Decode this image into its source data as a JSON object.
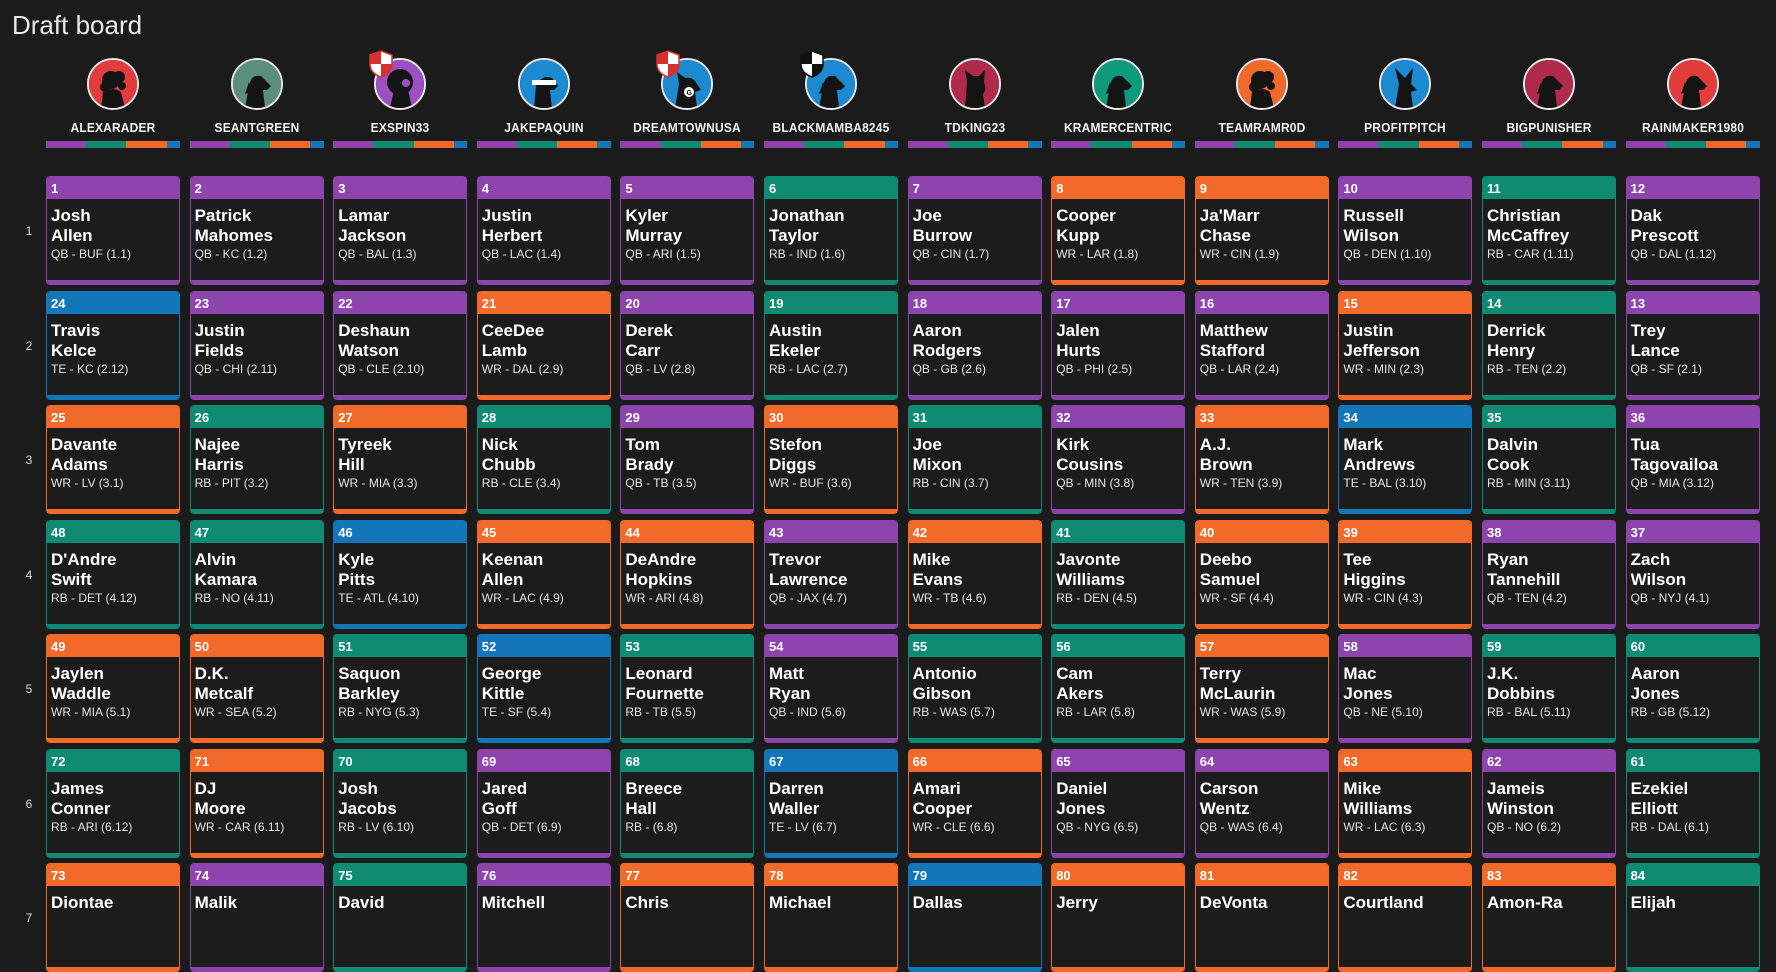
{
  "title": "Draft board",
  "colors": {
    "QB": "#8e44ad",
    "RB": "#0f8b74",
    "WR": "#f26a2a",
    "TE": "#1276b8"
  },
  "teams": [
    {
      "name": "ALEXARADER",
      "avatar_bg": "#e23c3c",
      "icon": "poodle-icon",
      "shield": false
    },
    {
      "name": "SEANTGREEN",
      "avatar_bg": "#5b8e7d",
      "icon": "dog-icon",
      "shield": false
    },
    {
      "name": "EXSPIN33",
      "avatar_bg": "#9b4fc0",
      "icon": "lion-icon",
      "shield": true,
      "shield_colors": [
        "#d8302e",
        "#ffffff"
      ]
    },
    {
      "name": "JAKEPAQUIN",
      "avatar_bg": "#1b8ad0",
      "icon": "dog-bandana-icon",
      "shield": false
    },
    {
      "name": "DREAMTOWNUSA",
      "avatar_bg": "#1b8ad0",
      "icon": "dog-g-icon",
      "shield": true,
      "shield_colors": [
        "#d8302e",
        "#ffffff"
      ]
    },
    {
      "name": "BLACKMAMBA8245",
      "avatar_bg": "#1b8ad0",
      "icon": "dog-icon",
      "shield": true,
      "shield_colors": [
        "#111111",
        "#ffffff"
      ]
    },
    {
      "name": "TDKING23",
      "avatar_bg": "#b02a4c",
      "icon": "cat-icon",
      "shield": false
    },
    {
      "name": "KRAMERCENTRIC",
      "avatar_bg": "#0f9a7e",
      "icon": "dog-icon",
      "shield": false
    },
    {
      "name": "TEAMRAMR0D",
      "avatar_bg": "#f26a2a",
      "icon": "poodle-icon",
      "shield": false
    },
    {
      "name": "PROFITPITCH",
      "avatar_bg": "#1b8ad0",
      "icon": "wolf-icon",
      "shield": false
    },
    {
      "name": "BIGPUNISHER",
      "avatar_bg": "#b02a4c",
      "icon": "dog-icon",
      "shield": false
    },
    {
      "name": "RAINMAKER1980",
      "avatar_bg": "#e23c3c",
      "icon": "dog-icon",
      "shield": false
    }
  ],
  "rounds": [
    {
      "label": "1",
      "picks": [
        {
          "num": "1",
          "first": "Josh",
          "last": "Allen",
          "meta": "QB - BUF (1.1)",
          "pos": "QB"
        },
        {
          "num": "2",
          "first": "Patrick",
          "last": "Mahomes",
          "meta": "QB - KC (1.2)",
          "pos": "QB"
        },
        {
          "num": "3",
          "first": "Lamar",
          "last": "Jackson",
          "meta": "QB - BAL (1.3)",
          "pos": "QB"
        },
        {
          "num": "4",
          "first": "Justin",
          "last": "Herbert",
          "meta": "QB - LAC (1.4)",
          "pos": "QB"
        },
        {
          "num": "5",
          "first": "Kyler",
          "last": "Murray",
          "meta": "QB - ARI (1.5)",
          "pos": "QB"
        },
        {
          "num": "6",
          "first": "Jonathan",
          "last": "Taylor",
          "meta": "RB - IND (1.6)",
          "pos": "RB"
        },
        {
          "num": "7",
          "first": "Joe",
          "last": "Burrow",
          "meta": "QB - CIN (1.7)",
          "pos": "QB"
        },
        {
          "num": "8",
          "first": "Cooper",
          "last": "Kupp",
          "meta": "WR - LAR (1.8)",
          "pos": "WR"
        },
        {
          "num": "9",
          "first": "Ja'Marr",
          "last": "Chase",
          "meta": "WR - CIN (1.9)",
          "pos": "WR"
        },
        {
          "num": "10",
          "first": "Russell",
          "last": "Wilson",
          "meta": "QB - DEN (1.10)",
          "pos": "QB"
        },
        {
          "num": "11",
          "first": "Christian",
          "last": "McCaffrey",
          "meta": "RB - CAR (1.11)",
          "pos": "RB"
        },
        {
          "num": "12",
          "first": "Dak",
          "last": "Prescott",
          "meta": "QB - DAL (1.12)",
          "pos": "QB"
        }
      ]
    },
    {
      "label": "2",
      "picks": [
        {
          "num": "24",
          "first": "Travis",
          "last": "Kelce",
          "meta": "TE - KC (2.12)",
          "pos": "TE"
        },
        {
          "num": "23",
          "first": "Justin",
          "last": "Fields",
          "meta": "QB - CHI (2.11)",
          "pos": "QB"
        },
        {
          "num": "22",
          "first": "Deshaun",
          "last": "Watson",
          "meta": "QB - CLE (2.10)",
          "pos": "QB"
        },
        {
          "num": "21",
          "first": "CeeDee",
          "last": "Lamb",
          "meta": "WR - DAL (2.9)",
          "pos": "WR"
        },
        {
          "num": "20",
          "first": "Derek",
          "last": "Carr",
          "meta": "QB - LV (2.8)",
          "pos": "QB"
        },
        {
          "num": "19",
          "first": "Austin",
          "last": "Ekeler",
          "meta": "RB - LAC (2.7)",
          "pos": "RB"
        },
        {
          "num": "18",
          "first": "Aaron",
          "last": "Rodgers",
          "meta": "QB - GB (2.6)",
          "pos": "QB"
        },
        {
          "num": "17",
          "first": "Jalen",
          "last": "Hurts",
          "meta": "QB - PHI (2.5)",
          "pos": "QB"
        },
        {
          "num": "16",
          "first": "Matthew",
          "last": "Stafford",
          "meta": "QB - LAR (2.4)",
          "pos": "QB"
        },
        {
          "num": "15",
          "first": "Justin",
          "last": "Jefferson",
          "meta": "WR - MIN (2.3)",
          "pos": "WR"
        },
        {
          "num": "14",
          "first": "Derrick",
          "last": "Henry",
          "meta": "RB - TEN (2.2)",
          "pos": "RB"
        },
        {
          "num": "13",
          "first": "Trey",
          "last": "Lance",
          "meta": "QB - SF (2.1)",
          "pos": "QB"
        }
      ]
    },
    {
      "label": "3",
      "picks": [
        {
          "num": "25",
          "first": "Davante",
          "last": "Adams",
          "meta": "WR - LV (3.1)",
          "pos": "WR"
        },
        {
          "num": "26",
          "first": "Najee",
          "last": "Harris",
          "meta": "RB - PIT (3.2)",
          "pos": "RB"
        },
        {
          "num": "27",
          "first": "Tyreek",
          "last": "Hill",
          "meta": "WR - MIA (3.3)",
          "pos": "WR"
        },
        {
          "num": "28",
          "first": "Nick",
          "last": "Chubb",
          "meta": "RB - CLE (3.4)",
          "pos": "RB"
        },
        {
          "num": "29",
          "first": "Tom",
          "last": "Brady",
          "meta": "QB - TB (3.5)",
          "pos": "QB"
        },
        {
          "num": "30",
          "first": "Stefon",
          "last": "Diggs",
          "meta": "WR - BUF (3.6)",
          "pos": "WR"
        },
        {
          "num": "31",
          "first": "Joe",
          "last": "Mixon",
          "meta": "RB - CIN (3.7)",
          "pos": "RB"
        },
        {
          "num": "32",
          "first": "Kirk",
          "last": "Cousins",
          "meta": "QB - MIN (3.8)",
          "pos": "QB"
        },
        {
          "num": "33",
          "first": "A.J.",
          "last": "Brown",
          "meta": "WR - TEN (3.9)",
          "pos": "WR"
        },
        {
          "num": "34",
          "first": "Mark",
          "last": "Andrews",
          "meta": "TE - BAL (3.10)",
          "pos": "TE"
        },
        {
          "num": "35",
          "first": "Dalvin",
          "last": "Cook",
          "meta": "RB - MIN (3.11)",
          "pos": "RB"
        },
        {
          "num": "36",
          "first": "Tua",
          "last": "Tagovailoa",
          "meta": "QB - MIA (3.12)",
          "pos": "QB"
        }
      ]
    },
    {
      "label": "4",
      "picks": [
        {
          "num": "48",
          "first": "D'Andre",
          "last": "Swift",
          "meta": "RB - DET (4.12)",
          "pos": "RB"
        },
        {
          "num": "47",
          "first": "Alvin",
          "last": "Kamara",
          "meta": "RB - NO (4.11)",
          "pos": "RB"
        },
        {
          "num": "46",
          "first": "Kyle",
          "last": "Pitts",
          "meta": "TE - ATL (4.10)",
          "pos": "TE"
        },
        {
          "num": "45",
          "first": "Keenan",
          "last": "Allen",
          "meta": "WR - LAC (4.9)",
          "pos": "WR"
        },
        {
          "num": "44",
          "first": "DeAndre",
          "last": "Hopkins",
          "meta": "WR - ARI (4.8)",
          "pos": "WR"
        },
        {
          "num": "43",
          "first": "Trevor",
          "last": "Lawrence",
          "meta": "QB - JAX (4.7)",
          "pos": "QB"
        },
        {
          "num": "42",
          "first": "Mike",
          "last": "Evans",
          "meta": "WR - TB (4.6)",
          "pos": "WR"
        },
        {
          "num": "41",
          "first": "Javonte",
          "last": "Williams",
          "meta": "RB - DEN (4.5)",
          "pos": "RB"
        },
        {
          "num": "40",
          "first": "Deebo",
          "last": "Samuel",
          "meta": "WR - SF (4.4)",
          "pos": "WR"
        },
        {
          "num": "39",
          "first": "Tee",
          "last": "Higgins",
          "meta": "WR - CIN (4.3)",
          "pos": "WR"
        },
        {
          "num": "38",
          "first": "Ryan",
          "last": "Tannehill",
          "meta": "QB - TEN (4.2)",
          "pos": "QB"
        },
        {
          "num": "37",
          "first": "Zach",
          "last": "Wilson",
          "meta": "QB - NYJ (4.1)",
          "pos": "QB"
        }
      ]
    },
    {
      "label": "5",
      "picks": [
        {
          "num": "49",
          "first": "Jaylen",
          "last": "Waddle",
          "meta": "WR - MIA (5.1)",
          "pos": "WR"
        },
        {
          "num": "50",
          "first": "D.K.",
          "last": "Metcalf",
          "meta": "WR - SEA (5.2)",
          "pos": "WR"
        },
        {
          "num": "51",
          "first": "Saquon",
          "last": "Barkley",
          "meta": "RB - NYG (5.3)",
          "pos": "RB"
        },
        {
          "num": "52",
          "first": "George",
          "last": "Kittle",
          "meta": "TE - SF (5.4)",
          "pos": "TE"
        },
        {
          "num": "53",
          "first": "Leonard",
          "last": "Fournette",
          "meta": "RB - TB (5.5)",
          "pos": "RB"
        },
        {
          "num": "54",
          "first": "Matt",
          "last": "Ryan",
          "meta": "QB - IND (5.6)",
          "pos": "QB"
        },
        {
          "num": "55",
          "first": "Antonio",
          "last": "Gibson",
          "meta": "RB - WAS (5.7)",
          "pos": "RB"
        },
        {
          "num": "56",
          "first": "Cam",
          "last": "Akers",
          "meta": "RB - LAR (5.8)",
          "pos": "RB"
        },
        {
          "num": "57",
          "first": "Terry",
          "last": "McLaurin",
          "meta": "WR - WAS (5.9)",
          "pos": "WR"
        },
        {
          "num": "58",
          "first": "Mac",
          "last": "Jones",
          "meta": "QB - NE (5.10)",
          "pos": "QB"
        },
        {
          "num": "59",
          "first": "J.K.",
          "last": "Dobbins",
          "meta": "RB - BAL (5.11)",
          "pos": "RB"
        },
        {
          "num": "60",
          "first": "Aaron",
          "last": "Jones",
          "meta": "RB - GB (5.12)",
          "pos": "RB"
        }
      ]
    },
    {
      "label": "6",
      "picks": [
        {
          "num": "72",
          "first": "James",
          "last": "Conner",
          "meta": "RB - ARI (6.12)",
          "pos": "RB"
        },
        {
          "num": "71",
          "first": "DJ",
          "last": "Moore",
          "meta": "WR - CAR (6.11)",
          "pos": "WR"
        },
        {
          "num": "70",
          "first": "Josh",
          "last": "Jacobs",
          "meta": "RB - LV (6.10)",
          "pos": "RB"
        },
        {
          "num": "69",
          "first": "Jared",
          "last": "Goff",
          "meta": "QB - DET (6.9)",
          "pos": "QB"
        },
        {
          "num": "68",
          "first": "Breece",
          "last": "Hall",
          "meta": "RB - (6.8)",
          "pos": "RB"
        },
        {
          "num": "67",
          "first": "Darren",
          "last": "Waller",
          "meta": "TE - LV (6.7)",
          "pos": "TE"
        },
        {
          "num": "66",
          "first": "Amari",
          "last": "Cooper",
          "meta": "WR - CLE (6.6)",
          "pos": "WR"
        },
        {
          "num": "65",
          "first": "Daniel",
          "last": "Jones",
          "meta": "QB - NYG (6.5)",
          "pos": "QB"
        },
        {
          "num": "64",
          "first": "Carson",
          "last": "Wentz",
          "meta": "QB - WAS (6.4)",
          "pos": "QB"
        },
        {
          "num": "63",
          "first": "Mike",
          "last": "Williams",
          "meta": "WR - LAC (6.3)",
          "pos": "WR"
        },
        {
          "num": "62",
          "first": "Jameis",
          "last": "Winston",
          "meta": "QB - NO (6.2)",
          "pos": "QB"
        },
        {
          "num": "61",
          "first": "Ezekiel",
          "last": "Elliott",
          "meta": "RB - DAL (6.1)",
          "pos": "RB"
        }
      ]
    },
    {
      "label": "7",
      "picks": [
        {
          "num": "73",
          "first": "Diontae",
          "last": "",
          "meta": "",
          "pos": "WR"
        },
        {
          "num": "74",
          "first": "Malik",
          "last": "",
          "meta": "",
          "pos": "QB"
        },
        {
          "num": "75",
          "first": "David",
          "last": "",
          "meta": "",
          "pos": "RB"
        },
        {
          "num": "76",
          "first": "Mitchell",
          "last": "",
          "meta": "",
          "pos": "QB"
        },
        {
          "num": "77",
          "first": "Chris",
          "last": "",
          "meta": "",
          "pos": "WR"
        },
        {
          "num": "78",
          "first": "Michael",
          "last": "",
          "meta": "",
          "pos": "WR"
        },
        {
          "num": "79",
          "first": "Dallas",
          "last": "",
          "meta": "",
          "pos": "TE"
        },
        {
          "num": "80",
          "first": "Jerry",
          "last": "",
          "meta": "",
          "pos": "WR"
        },
        {
          "num": "81",
          "first": "DeVonta",
          "last": "",
          "meta": "",
          "pos": "WR"
        },
        {
          "num": "82",
          "first": "Courtland",
          "last": "",
          "meta": "",
          "pos": "WR"
        },
        {
          "num": "83",
          "first": "Amon-Ra",
          "last": "",
          "meta": "",
          "pos": "WR"
        },
        {
          "num": "84",
          "first": "Elijah",
          "last": "",
          "meta": "",
          "pos": "RB"
        }
      ]
    }
  ]
}
